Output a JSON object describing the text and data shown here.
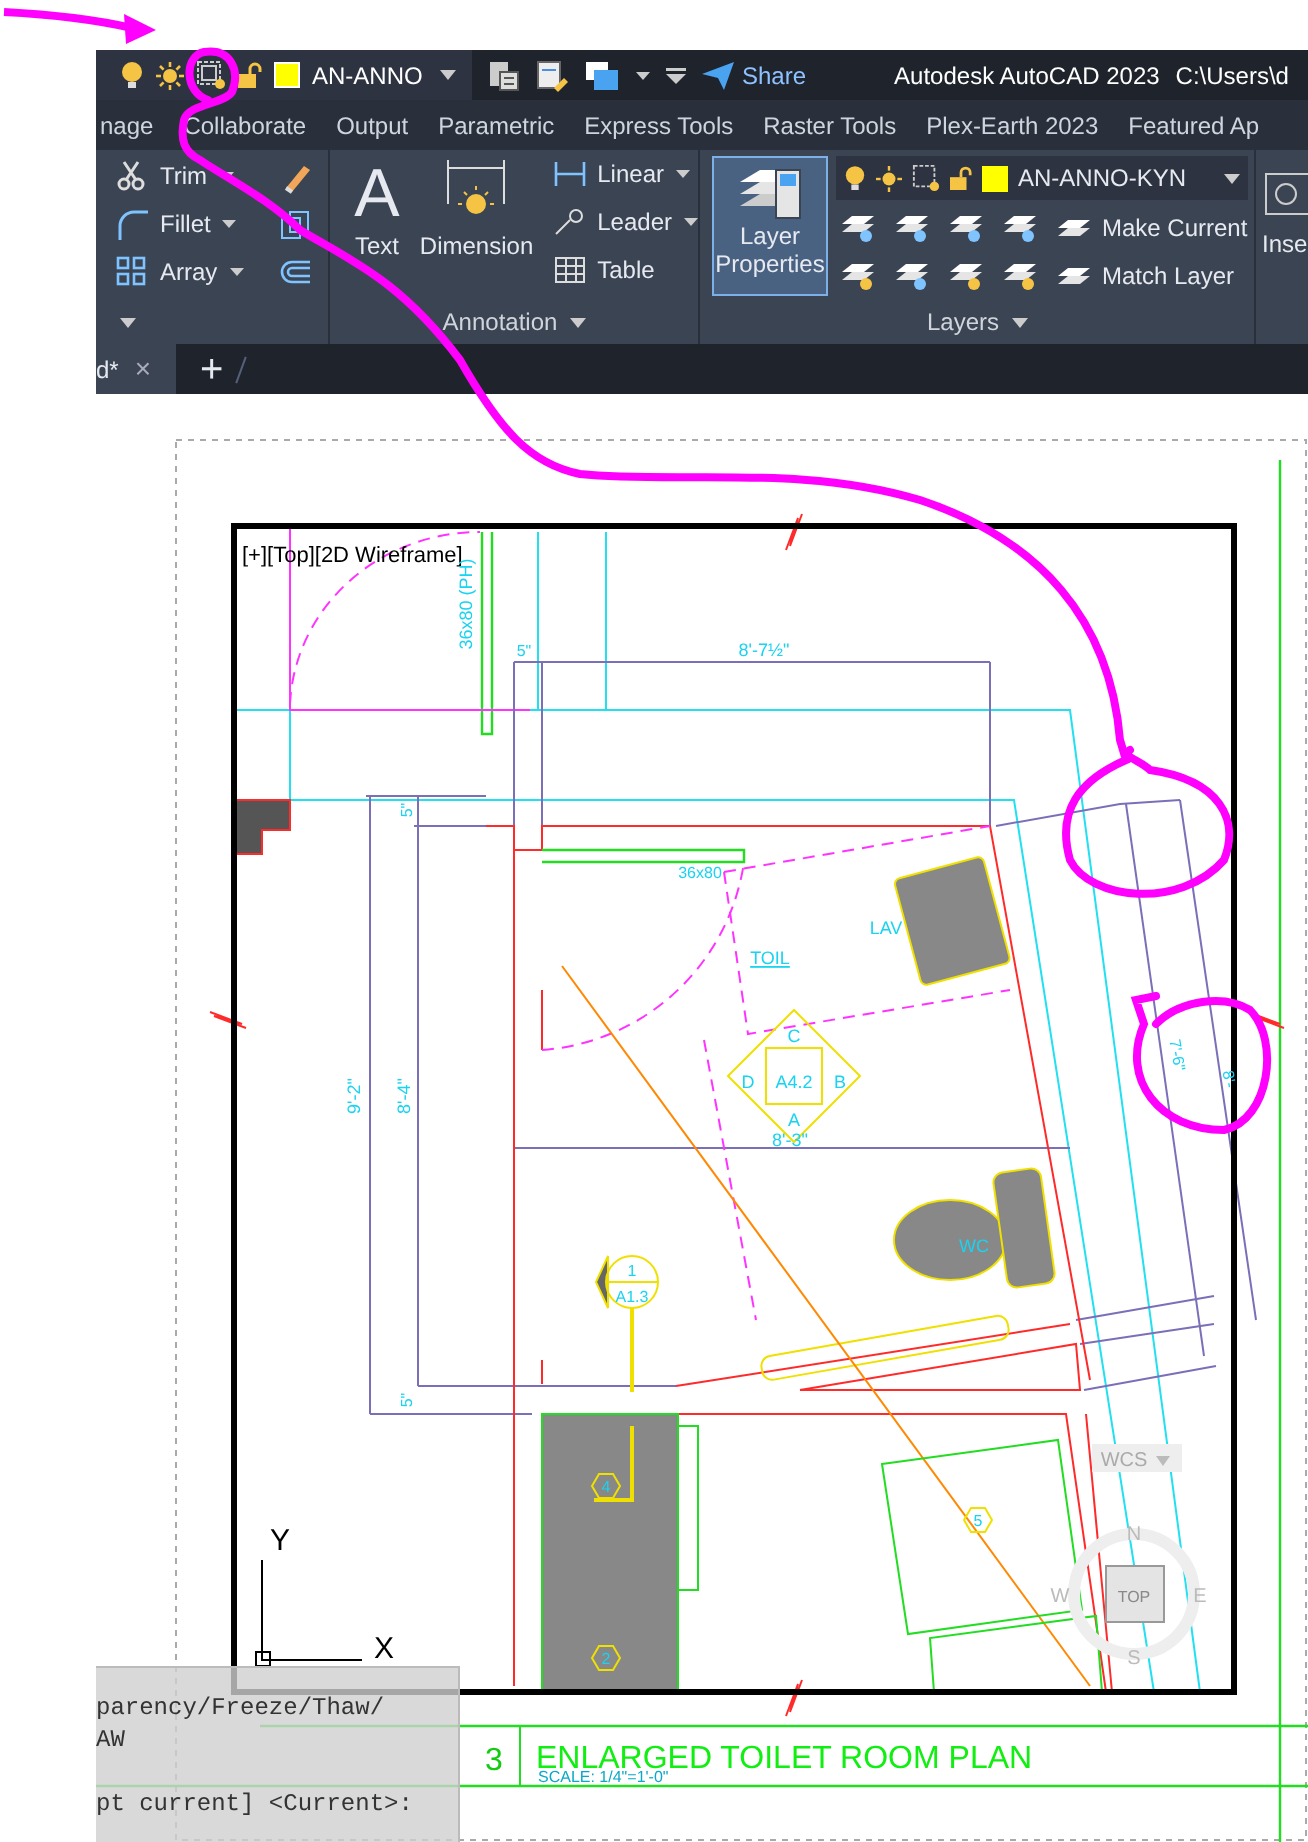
{
  "quick_access": {
    "current_layer": "AN-ANNO",
    "share": "Share"
  },
  "title_bar": {
    "app": "Autodesk AutoCAD 2023",
    "path": "C:\\Users\\d"
  },
  "ribbon_tabs": [
    "nage",
    "Collaborate",
    "Output",
    "Parametric",
    "Express Tools",
    "Raster Tools",
    "Plex-Earth 2023",
    "Featured Ap"
  ],
  "ribbon": {
    "modify": {
      "tools": [
        "Trim",
        "Fillet",
        "Array"
      ]
    },
    "annotation": {
      "title": "Annotation",
      "text_glyph": "A",
      "big_tools": [
        "Text",
        "Dimension"
      ],
      "tools": [
        "Linear",
        "Leader",
        "Table"
      ]
    },
    "layers": {
      "title": "Layers",
      "button": "Layer Properties",
      "current_layer": "AN-ANNO-KYN",
      "tools": [
        "Make Current",
        "Match Layer"
      ]
    },
    "insert": {
      "label": "Inse"
    }
  },
  "document_tabs": [
    {
      "label": "d*",
      "close": "×"
    }
  ],
  "new_tab": "+",
  "viewport": {
    "label": "[+][Top][2D Wireframe]"
  },
  "drawing_labels": [
    "5\"",
    "8'-7½\"",
    "36x80 (PH)",
    "5\"",
    "36x80",
    "TOIL",
    "LAV",
    "C",
    "D",
    "A4.2",
    "B",
    "A",
    "8'-3\"",
    "9'-2\"",
    "8'-4\"",
    "7'-6\"",
    "8'-",
    "WC",
    "1",
    "A1.3",
    "5\"",
    "4",
    "5",
    "2"
  ],
  "view_cube": {
    "wcs": "WCS",
    "north": "N",
    "west": "W",
    "east": "E",
    "south": "S",
    "face": "TOP"
  },
  "ucs": {
    "y": "Y",
    "x": "X"
  },
  "title_block": {
    "number": "3",
    "title": "ENLARGED TOILET ROOM PLAN",
    "scale": "SCALE: 1/4\"=1'-0\""
  },
  "command_line": [
    "parency/Freeze/Thaw/",
    "AW",
    "pt current] <Current>:"
  ]
}
